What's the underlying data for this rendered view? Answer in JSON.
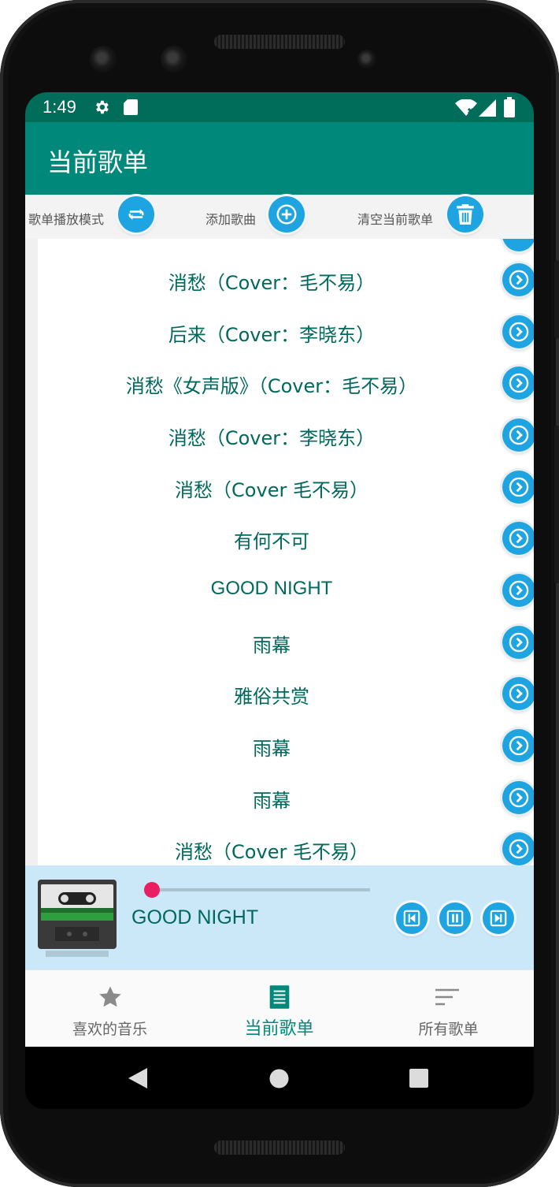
{
  "status_bar": {
    "time": "1:49",
    "left_icons": [
      "gear-icon",
      "sd-card-icon"
    ],
    "right_icons": [
      "wifi-icon",
      "signal-icon",
      "battery-icon"
    ]
  },
  "toolbar": {
    "title": "当前歌单"
  },
  "actions": {
    "play_mode_label": "歌单播放模式",
    "add_song_label": "添加歌曲",
    "clear_playlist_label": "清空当前歌单",
    "play_mode_icon": "repeat-icon",
    "add_song_icon": "plus-circle-icon",
    "clear_icon": "trash-icon"
  },
  "playlist": {
    "items": [
      {
        "title": "消愁（Cover：毛不易）"
      },
      {
        "title": "后来（Cover：李晓东）"
      },
      {
        "title": "消愁《女声版》（Cover：毛不易）"
      },
      {
        "title": "消愁（Cover：李晓东）"
      },
      {
        "title": "消愁（Cover 毛不易）"
      },
      {
        "title": "有何不可"
      },
      {
        "title": "GOOD NIGHT"
      },
      {
        "title": "雨幕"
      },
      {
        "title": "雅俗共赏"
      },
      {
        "title": "雨幕"
      },
      {
        "title": "雨幕"
      },
      {
        "title": "消愁（Cover 毛不易）"
      }
    ],
    "item_button_icon": "chevron-right-circle-icon"
  },
  "player": {
    "now_playing": "GOOD NIGHT",
    "progress": 0.0,
    "cover_icon": "cassette-tape-icon",
    "controls": [
      "skip-previous-icon",
      "pause-icon",
      "skip-next-icon"
    ]
  },
  "bottom_nav": {
    "items": [
      {
        "label": "喜欢的音乐",
        "icon": "star-icon",
        "active": false
      },
      {
        "label": "当前歌单",
        "icon": "list-document-icon",
        "active": true
      },
      {
        "label": "所有歌单",
        "icon": "sort-lines-icon",
        "active": false
      }
    ]
  },
  "system_nav": [
    "back-icon",
    "home-icon",
    "recents-icon"
  ],
  "colors": {
    "primary": "#00897b",
    "primary_dark": "#006c5a",
    "accent_button": "#1ea4e0",
    "progress": "#e91e63",
    "song_text": "#00695c",
    "player_bg": "#cbe8f9"
  }
}
